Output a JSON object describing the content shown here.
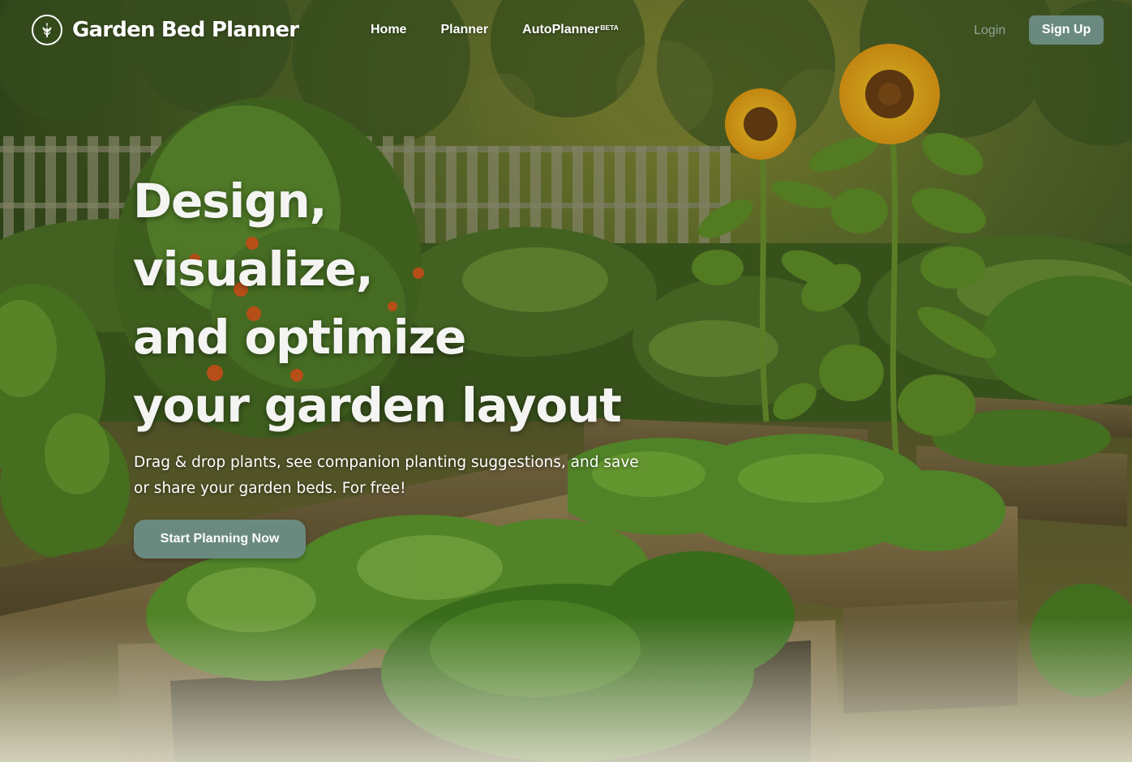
{
  "brand": {
    "name": "Garden Bed Planner",
    "logo_icon": "sprout-icon"
  },
  "nav": {
    "home": "Home",
    "planner": "Planner",
    "autoplanner": "AutoPlanner",
    "autoplanner_badge": "BETA"
  },
  "auth": {
    "login": "Login",
    "signup": "Sign Up"
  },
  "hero": {
    "title_lines": [
      "Design,",
      "visualize,",
      "and optimize",
      "your garden layout"
    ],
    "subtitle_lines": [
      "Drag & drop plants, see companion planting suggestions, and save",
      "or share your garden beds. For free!"
    ],
    "cta": "Start Planning Now"
  },
  "colors": {
    "accent": "#6b8a7f",
    "login_text": "#8fa496",
    "text": "#ffffff"
  }
}
